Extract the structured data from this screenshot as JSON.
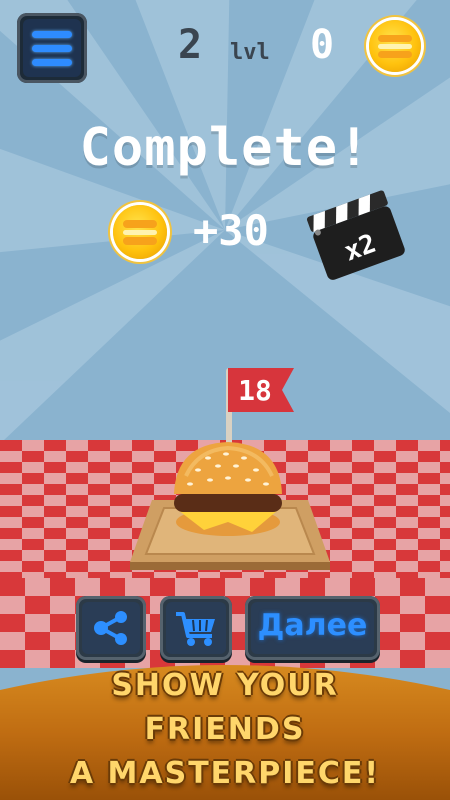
{
  "hud": {
    "level_number": "2",
    "level_label": "lvl",
    "coins": "0"
  },
  "result": {
    "title": "Complete!",
    "reward": "+30",
    "multiplier": "x2"
  },
  "flag": {
    "number": "18"
  },
  "buttons": {
    "share_icon": "share-icon",
    "shop_icon": "shopping-cart-icon",
    "next_label": "Далее"
  },
  "promo": {
    "line1": "SHOW YOUR",
    "line2": "FRIENDS",
    "line3": "A MASTERPIECE!"
  },
  "colors": {
    "sky": "#8ab3cf",
    "accent_blue": "#2d8fff",
    "coin": "#ffc20e",
    "tablecloth_red": "#d8383a",
    "promo_text": "#ffd66b"
  }
}
